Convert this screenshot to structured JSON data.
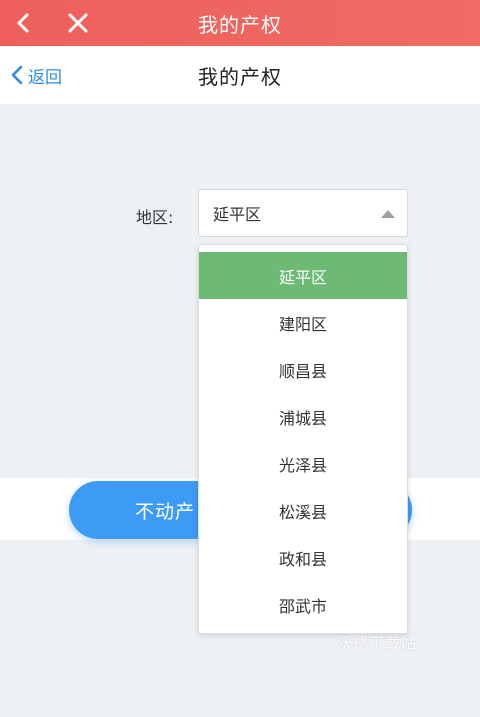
{
  "appbar": {
    "title": "我的产权",
    "back_icon": "chevron-left-icon",
    "close_icon": "close-icon",
    "color": "#ee5f5b"
  },
  "navbar": {
    "back_label": "返回",
    "title": "我的产权",
    "accent": "#2b8be6"
  },
  "form": {
    "region_label": "地区:",
    "region_selected": "延平区"
  },
  "dropdown": {
    "options": [
      "延平区",
      "建阳区",
      "顺昌县",
      "浦城县",
      "光泽县",
      "松溪县",
      "政和县",
      "邵武市"
    ],
    "selected_color": "#6cba74"
  },
  "button": {
    "label": "不动产",
    "color": "#3d9bf5"
  },
  "watermark": "沃德下载站"
}
